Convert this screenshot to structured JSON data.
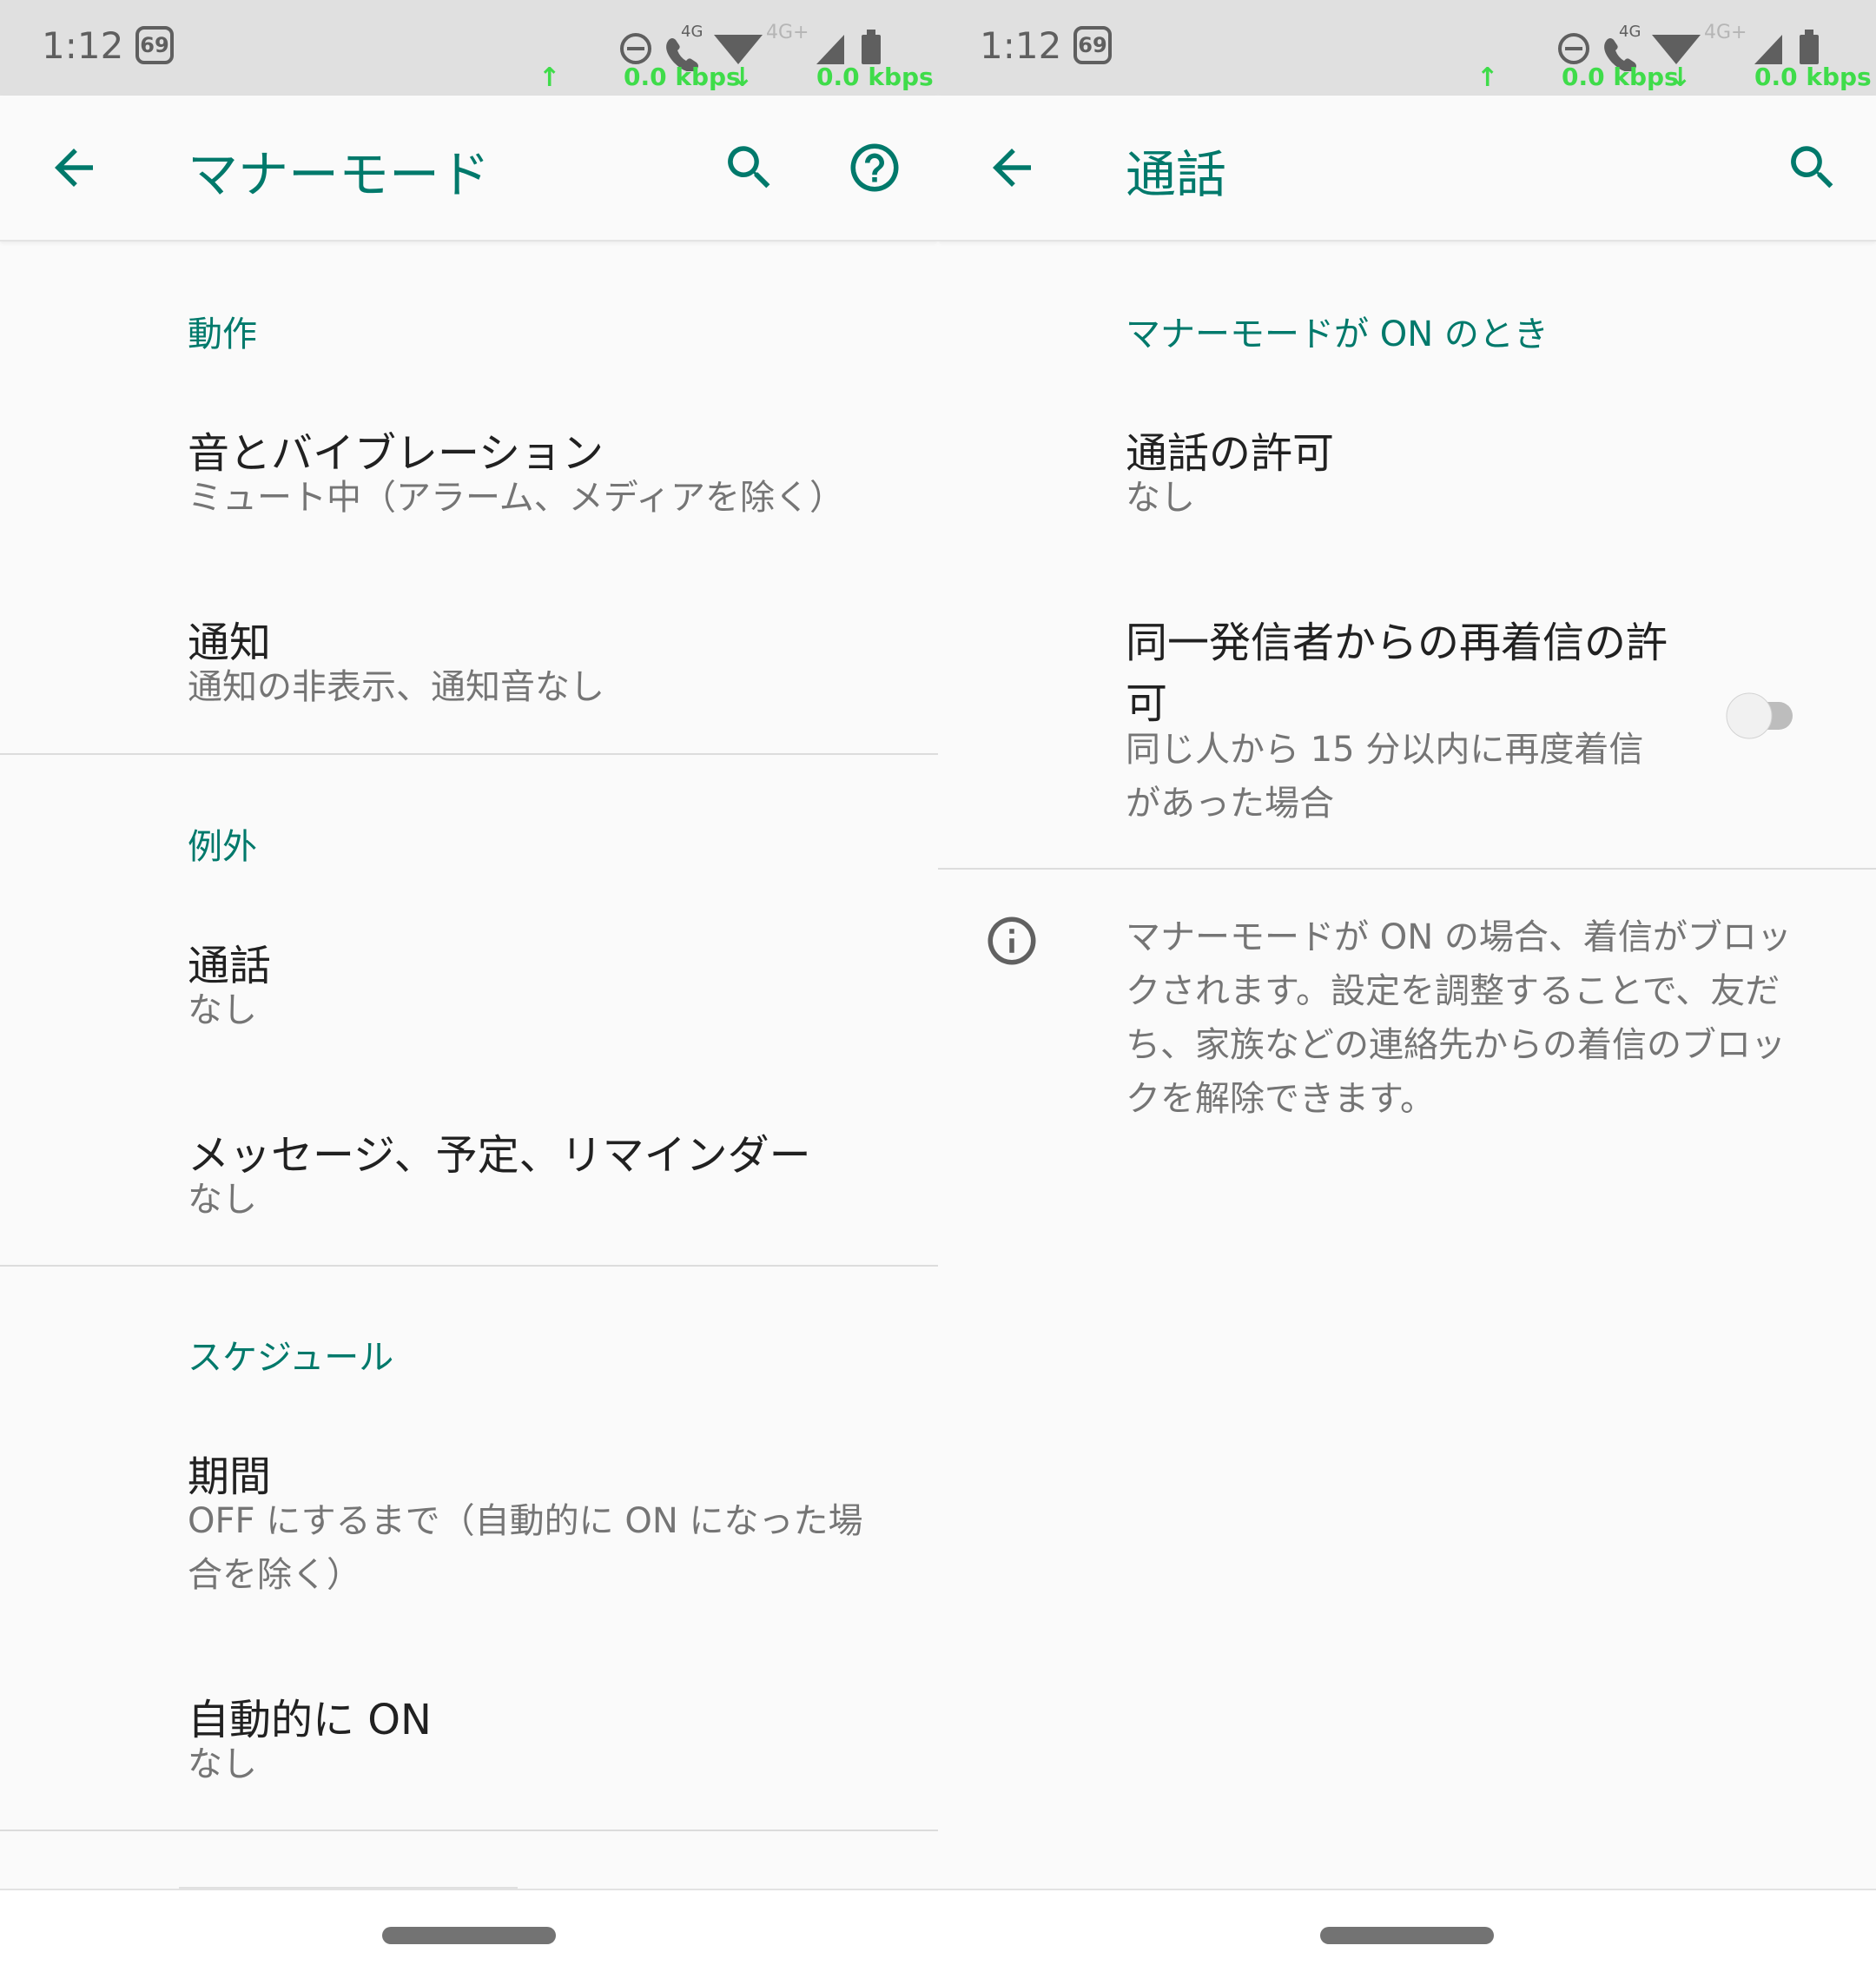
{
  "status_bar": {
    "time": "1:12",
    "badge": "69",
    "network_4g": "4G",
    "network_4gplus": "4G+",
    "speed_up": "0.0 kbps",
    "speed_down": "0.0 kbps",
    "speed_color": "#3fdc4a",
    "icons": [
      "dnd-icon",
      "wifi-calling-icon",
      "wifi-icon",
      "cell-signal-icon",
      "battery-icon"
    ]
  },
  "colors": {
    "accent": "#00796b",
    "text_primary": "#212121",
    "text_secondary": "#757575",
    "background": "#fafafa"
  },
  "left_panel": {
    "appbar": {
      "title": "マナーモード",
      "actions": [
        "search-icon",
        "help-icon"
      ]
    },
    "sections": [
      {
        "header": "動作",
        "items": [
          {
            "title": "音とバイブレーション",
            "subtitle": "ミュート中（アラーム、メディアを除く）"
          },
          {
            "title": "通知",
            "subtitle": "通知の非表示、通知音なし"
          }
        ]
      },
      {
        "header": "例外",
        "items": [
          {
            "title": "通話",
            "subtitle": "なし"
          },
          {
            "title": "メッセージ、予定、リマインダー",
            "subtitle": "なし"
          }
        ]
      },
      {
        "header": "スケジュール",
        "items": [
          {
            "title": "期間",
            "subtitle_lines": [
              "OFF にするまで（自動的に ON になった場",
              "合を除く）"
            ]
          },
          {
            "title": "自動的に ON",
            "subtitle": "なし"
          }
        ]
      }
    ]
  },
  "right_panel": {
    "appbar": {
      "title": "通話",
      "actions": [
        "search-icon"
      ]
    },
    "section_header": "マナーモードが ON のとき",
    "items": [
      {
        "title": "通話の許可",
        "subtitle": "なし"
      },
      {
        "title_lines": [
          "同一発信者からの再着信の許",
          "可"
        ],
        "subtitle_lines": [
          "同じ人から 15 分以内に再度着信",
          "があった場合"
        ],
        "toggle_on": false
      }
    ],
    "info_lines": [
      "マナーモードが ON の場合、着信がブロッ",
      "クされます。設定を調整することで、友だ",
      "ち、家族などの連絡先からの着信のブロッ",
      "クを解除できます。"
    ]
  }
}
